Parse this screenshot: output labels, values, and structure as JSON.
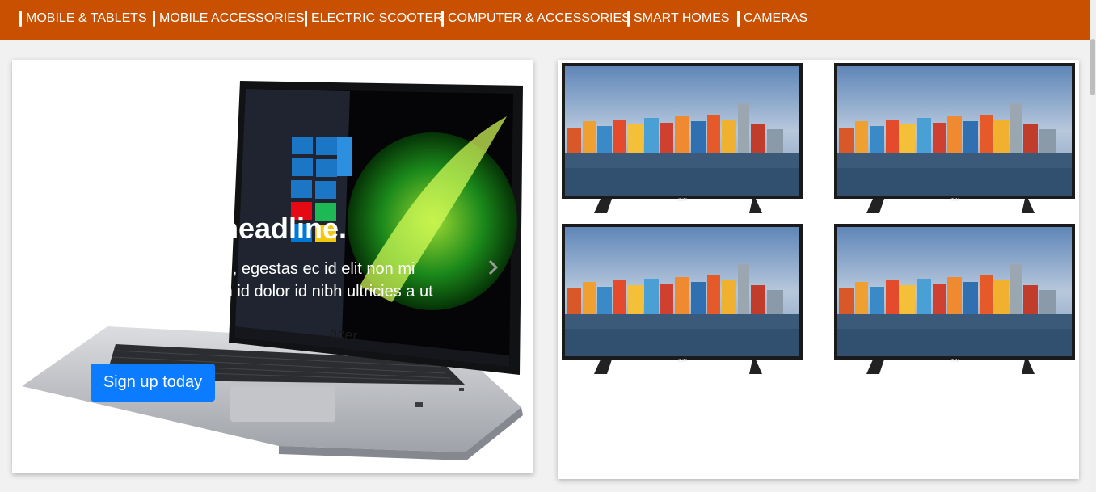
{
  "nav": {
    "items": [
      {
        "label": "MOBILE & TABLETS"
      },
      {
        "label": "MOBILE ACCESSORIES"
      },
      {
        "label": "ELECTRIC SCOOTER"
      },
      {
        "label": "COMPUTER & ACCESSORIES"
      },
      {
        "label": "SMART HOMES"
      },
      {
        "label": "CAMERAS"
      }
    ]
  },
  "carousel": {
    "headline": "headline.",
    "lead": "apibus ac facilisis in, egestas ec id elit non mi porta gravida at lam id dolor id nibh ultricies a ut id elit.",
    "button_label": "Sign up today",
    "laptop_brand": "acer"
  },
  "products": {
    "tv_brand": "ZUM"
  },
  "colors": {
    "nav_bg": "#c85000",
    "button_bg": "#0b7bff"
  }
}
